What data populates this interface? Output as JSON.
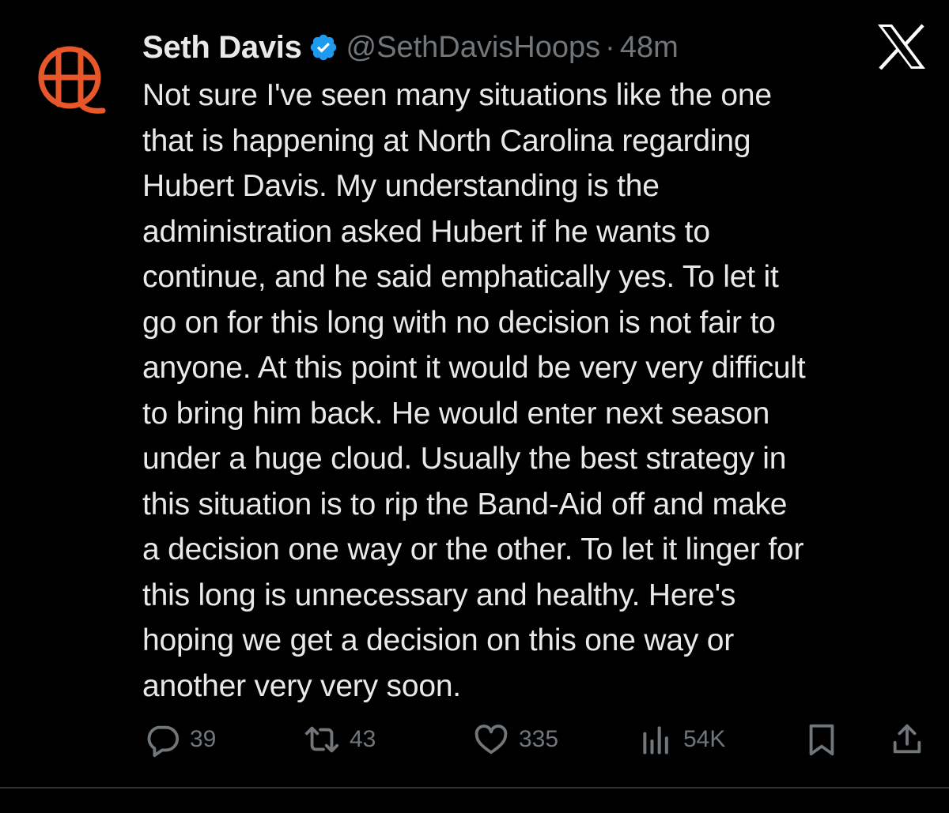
{
  "tweet": {
    "display_name": "Seth Davis",
    "handle": "@SethDavisHoops",
    "separator": "·",
    "timestamp": "48m",
    "lines": [
      "Not sure I've seen many situations like the one",
      "that is happening at North Carolina regarding",
      "Hubert Davis. My understanding is the",
      "administration asked Hubert if he wants to",
      "continue, and he said emphatically yes. To let it",
      "go on for this long with no decision is not fair to",
      "anyone. At this point it would be very very difficult",
      "to bring him back. He would enter next season",
      "under a huge cloud. Usually the best strategy in",
      "this situation is to rip the Band-Aid off and make",
      "a decision one way or the other. To let it linger for",
      "this long is unnecessary and healthy. Here's",
      "hoping we get a decision on this one way or",
      "another very very soon."
    ]
  },
  "actions": {
    "replies": "39",
    "reposts": "43",
    "likes": "335",
    "views": "54K"
  },
  "icons": {
    "avatar": "basketball-logo-icon",
    "verified": "verified-badge-icon",
    "brand": "x-logo-icon",
    "reply": "reply-icon",
    "repost": "repost-icon",
    "like": "heart-icon",
    "views": "views-chart-icon",
    "bookmark": "bookmark-icon",
    "share": "share-icon"
  },
  "colors": {
    "background": "#000000",
    "text": "#e7e9ea",
    "secondary": "#71767b",
    "verified": "#1d9bf0",
    "avatar": "#e8572a"
  }
}
